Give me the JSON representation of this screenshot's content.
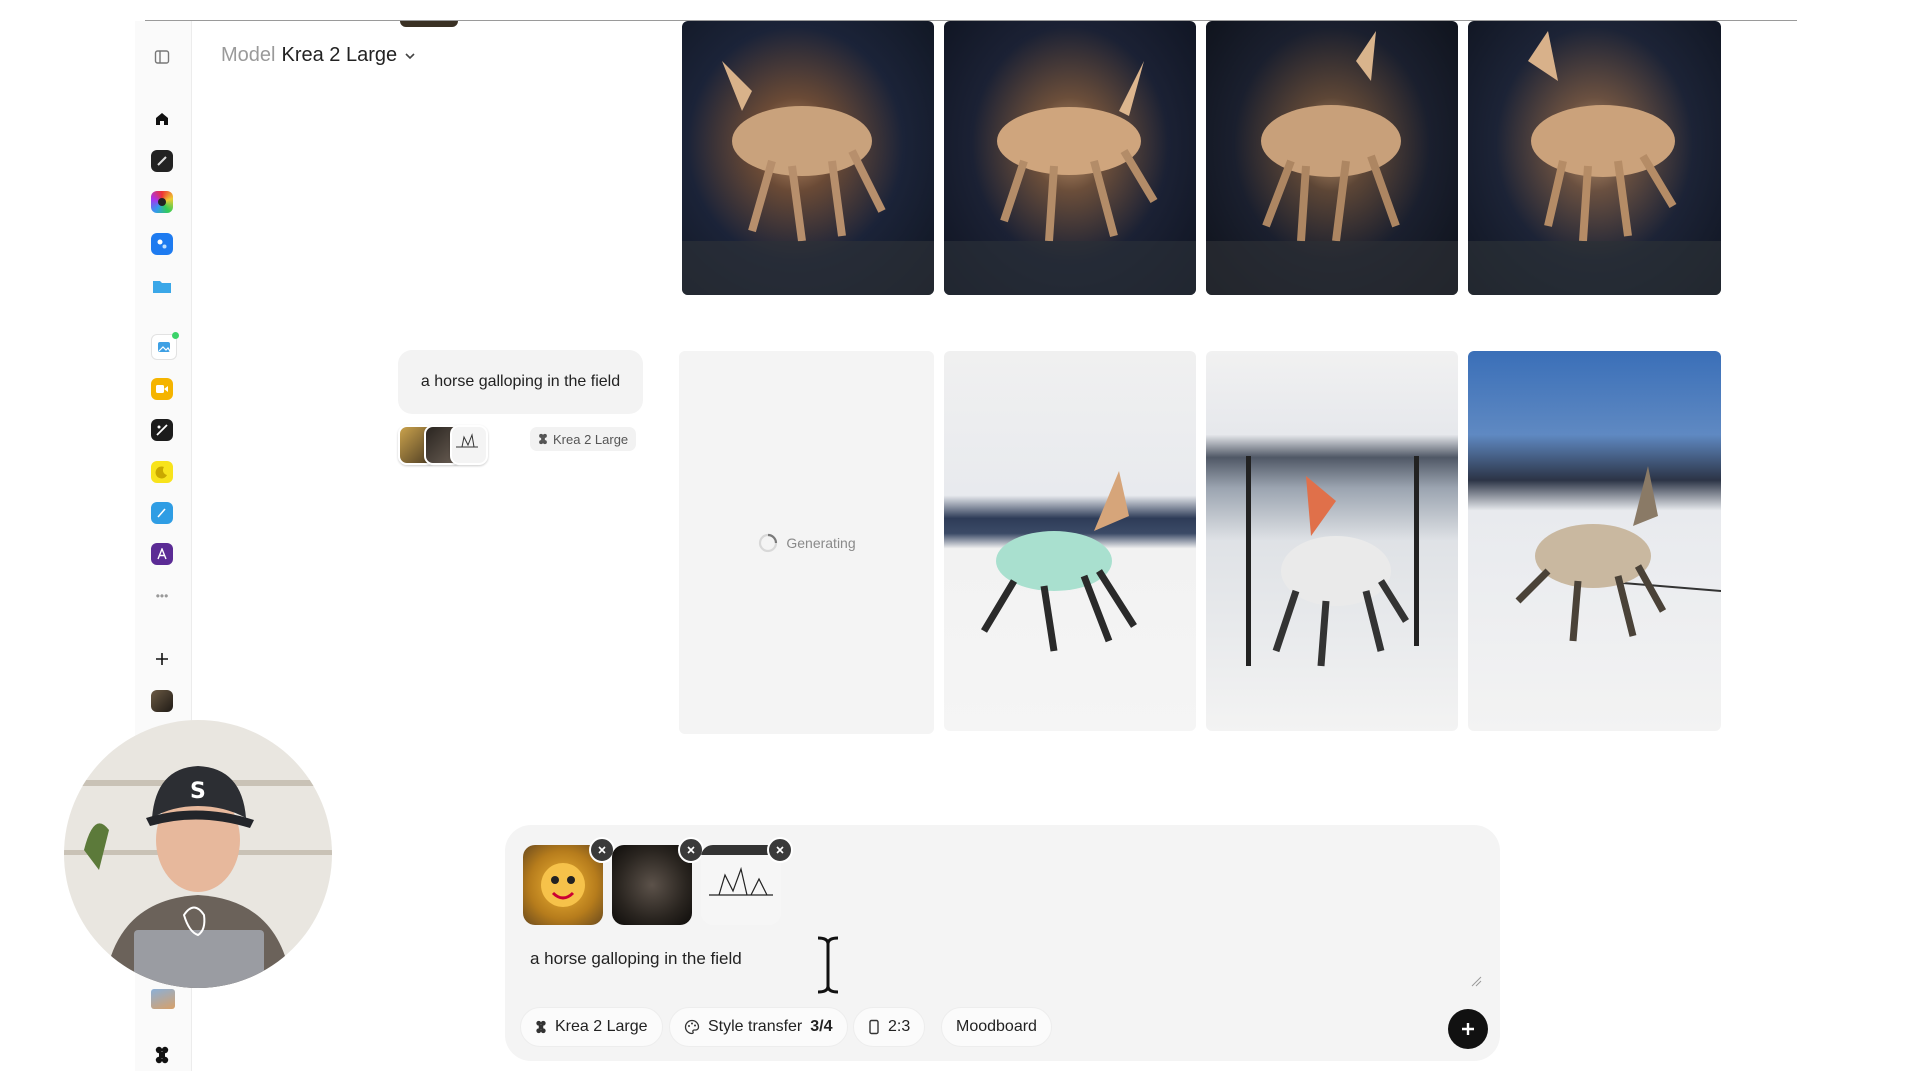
{
  "header": {
    "model_label": "Model",
    "model_value": "Krea 2 Large"
  },
  "sidebar": {
    "items": [
      {
        "name": "sidebar-toggle-icon"
      },
      {
        "name": "home-icon"
      },
      {
        "name": "tool-image-icon"
      },
      {
        "name": "tool-realtime-icon"
      },
      {
        "name": "tool-enhance-icon"
      },
      {
        "name": "tool-folder-icon"
      },
      {
        "name": "tool-image-editor-icon"
      },
      {
        "name": "tool-video-icon"
      },
      {
        "name": "tool-edit-icon"
      },
      {
        "name": "tool-moon-icon"
      },
      {
        "name": "tool-pen-icon"
      },
      {
        "name": "tool-logo-icon"
      },
      {
        "name": "more-icon"
      },
      {
        "name": "add-icon"
      }
    ],
    "more_label": "•••"
  },
  "history": {
    "prompt": "a horse galloping in the field",
    "model_chip": "Krea 2 Large",
    "generating_label": "Generating"
  },
  "composer": {
    "prompt_value": "a horse galloping in the field",
    "model_pill": "Krea 2 Large",
    "style_pill_label": "Style transfer",
    "style_pill_count": "3/4",
    "ratio_pill": "2:3",
    "moodboard_pill": "Moodboard",
    "reference_count": 3
  },
  "colors": {
    "accent_black": "#111111",
    "composer_bg": "#f4f4f4",
    "muted_text": "#9a9a9a"
  }
}
